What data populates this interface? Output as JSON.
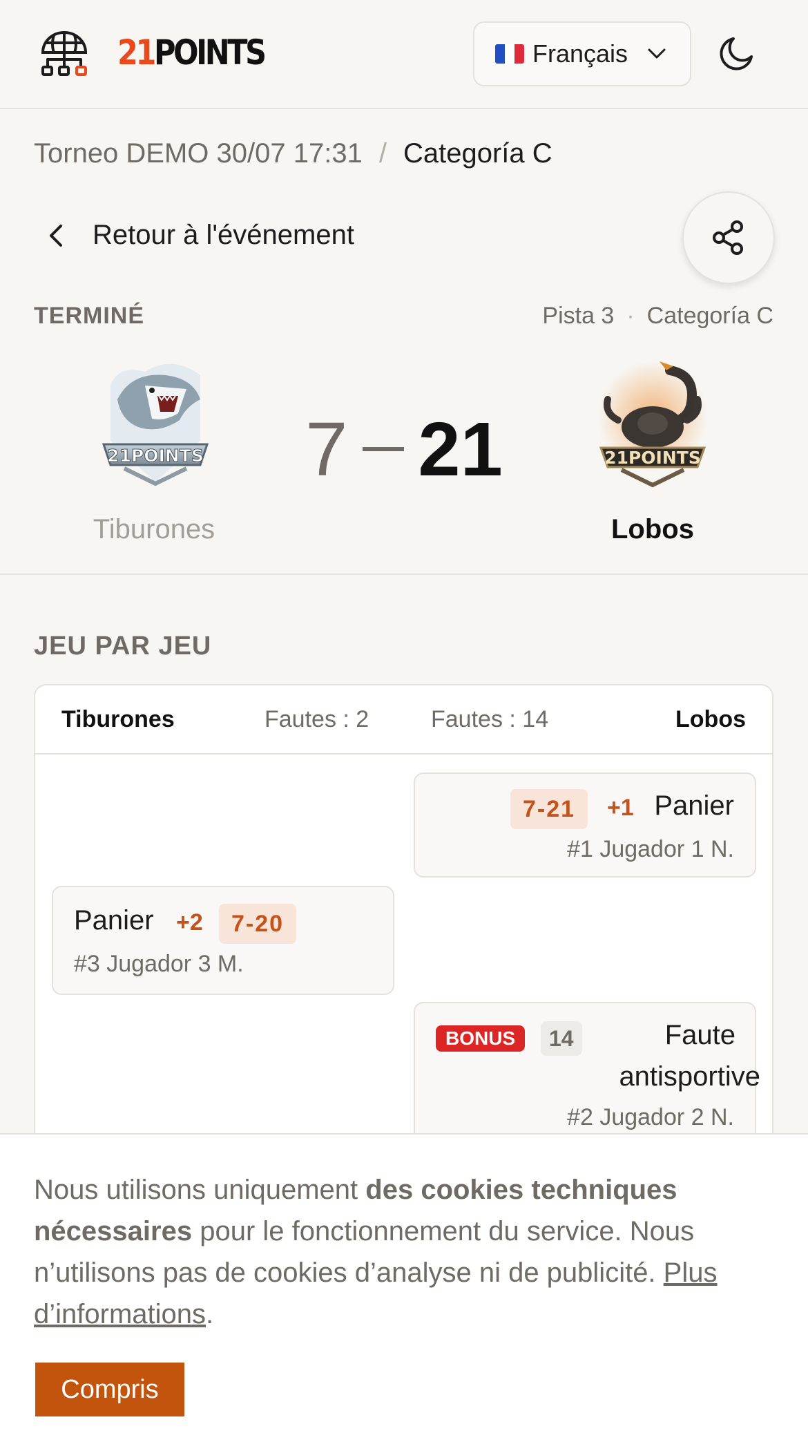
{
  "header": {
    "logo_number": "21",
    "logo_word": "POINTS",
    "language": "Français",
    "flag_icon": "flag-france-icon"
  },
  "breadcrumb": {
    "parent": "Torneo DEMO 30/07 17:31",
    "separator": "/",
    "current": "Categoría C"
  },
  "nav": {
    "back_label": "Retour à l'événement"
  },
  "match": {
    "status": "TERMINÉ",
    "court": "Pista 3",
    "dot": "·",
    "category": "Categoría C",
    "home": {
      "name": "Tiburones",
      "score": "7",
      "logo": "shark-team-logo"
    },
    "away": {
      "name": "Lobos",
      "score": "21",
      "logo": "scorpion-team-logo"
    }
  },
  "play_by_play": {
    "title": "JEU PAR JEU",
    "home_name": "Tiburones",
    "home_fouls": "Fautes : 2",
    "away_fouls": "Fautes : 14",
    "away_name": "Lobos",
    "events": [
      {
        "side": "away",
        "score": "7-21",
        "points": "+1",
        "title": "Panier",
        "player": "#1 Jugador 1 N."
      },
      {
        "side": "home",
        "score": "7-20",
        "points": "+2",
        "title": "Panier",
        "player": "#3 Jugador 3 M."
      },
      {
        "side": "away",
        "badge": "BONUS",
        "count": "14",
        "title_line1": "Faute",
        "title_line2": "antisportive",
        "player": "#2 Jugador 2 N."
      }
    ]
  },
  "cookie": {
    "text_a": "Nous utilisons uniquement ",
    "text_b": "des cookies techniques nécessaires",
    "text_c": " pour le fonctionnement du service. Nous n’utilisons pas de cookies d’analyse ni de publicité. ",
    "link": "Plus d’informations",
    "text_d": ".",
    "accept": "Compris"
  },
  "colors": {
    "accent": "#c2540e",
    "logo_orange": "#e8491d",
    "score_pill_bg": "#f8e4d8",
    "score_pill_text": "#c2531b",
    "bonus": "#dc2626"
  }
}
